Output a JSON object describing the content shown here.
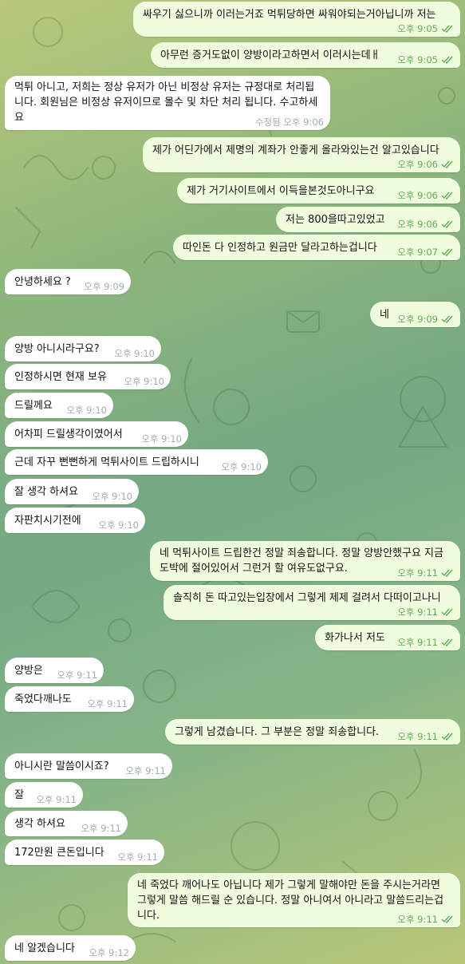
{
  "messages": [
    {
      "dir": "out",
      "text": "싸우기 싫으니까 이러는거죠 먹튀당하면 싸워야되는거아닙니까 저는",
      "time": "오후 9:05"
    },
    {
      "dir": "out",
      "text": "아무런 증거도없이 양방이라고하면서 이러시는데ㅐ",
      "time": "오후 9:05"
    },
    {
      "dir": "in",
      "text": "먹튀 아니고, 저희는 정상 유저가 아닌 비정상 유저는 규정대로 처리됩니다. 회원님은 비정상 유저이므로 몰수 및 차단 처리 됩니다. 수고하세요",
      "time": "수정됨 오후 9:06"
    },
    {
      "dir": "out",
      "text": "제가 어딘가에서 제명의 계좌가 안좋게 올라와있는건 알고있습니다",
      "time": "오후 9:06"
    },
    {
      "dir": "out",
      "text": "제가 거기사이트에서 이득을본것도아니구요",
      "time": "오후 9:06"
    },
    {
      "dir": "out",
      "text": "저는 800을따고있었고",
      "time": "오후 9:06"
    },
    {
      "dir": "out",
      "text": "따인돈 다 인정하고 원금만 달라고하는겁니다",
      "time": "오후 9:07"
    },
    {
      "dir": "in",
      "text": "안녕하세요 ?",
      "time": "오후 9:09"
    },
    {
      "dir": "out",
      "text": "네",
      "time": "오후 9:09"
    },
    {
      "dir": "in",
      "text": "양방 아니시라구요?",
      "time": "오후 9:10"
    },
    {
      "dir": "in",
      "text": "인정하시면 현재 보유",
      "time": "오후 9:10"
    },
    {
      "dir": "in",
      "text": "드릴께요",
      "time": "오후 9:10"
    },
    {
      "dir": "in",
      "text": "어차피 드릴생각이였어서",
      "time": "오후 9:10"
    },
    {
      "dir": "in",
      "text": "근데 자꾸 뻔뻔하게 먹튀사이트 드립하시니",
      "time": "오후 9:10"
    },
    {
      "dir": "in",
      "text": "잘 생각 하셔요",
      "time": "오후 9:10"
    },
    {
      "dir": "in",
      "text": "자판치시기전에",
      "time": "오후 9:10"
    },
    {
      "dir": "out",
      "text": "네 먹튀사이트 드립한건 정말 죄송합니다. 정말 양방안했구요 지금 도박에 절어있어서 그런거 할 여유도없구요.",
      "time": "오후 9:11"
    },
    {
      "dir": "out",
      "text": "솔직히 돈 따고있는입장에서 그렇게 제제 걸려서 다떠이고나니",
      "time": "오후 9:11"
    },
    {
      "dir": "out",
      "text": "화가나서 저도",
      "time": "오후 9:11"
    },
    {
      "dir": "in",
      "text": "양방은",
      "time": "오후 9:11"
    },
    {
      "dir": "in",
      "text": "죽었다깨나도",
      "time": "오후 9:11"
    },
    {
      "dir": "out",
      "text": "그렇게 남겼습니다. 그 부분은 정말 죄송합니다.",
      "time": "오후 9:11"
    },
    {
      "dir": "in",
      "text": "아니시란 말씀이시죠?",
      "time": "오후 9:11"
    },
    {
      "dir": "in",
      "text": "잘",
      "time": "오후 9:11"
    },
    {
      "dir": "in",
      "text": "생각 하셔요",
      "time": "오후 9:11"
    },
    {
      "dir": "in",
      "text": "172만원 큰돈입니다",
      "time": "오후 9:11"
    },
    {
      "dir": "out",
      "text": "네 죽었다 깨어나도 아닙니다 제가 그렇게 말해야만 돈을 주시는거라면 그렇게 말씀 해드릴 순 있습니다. 정말 아니여서 아니라고 말씀드리는겁니다.",
      "time": "오후 9:11"
    },
    {
      "dir": "in",
      "text": "네 알겠습니다",
      "time": "오후 9:12"
    }
  ]
}
